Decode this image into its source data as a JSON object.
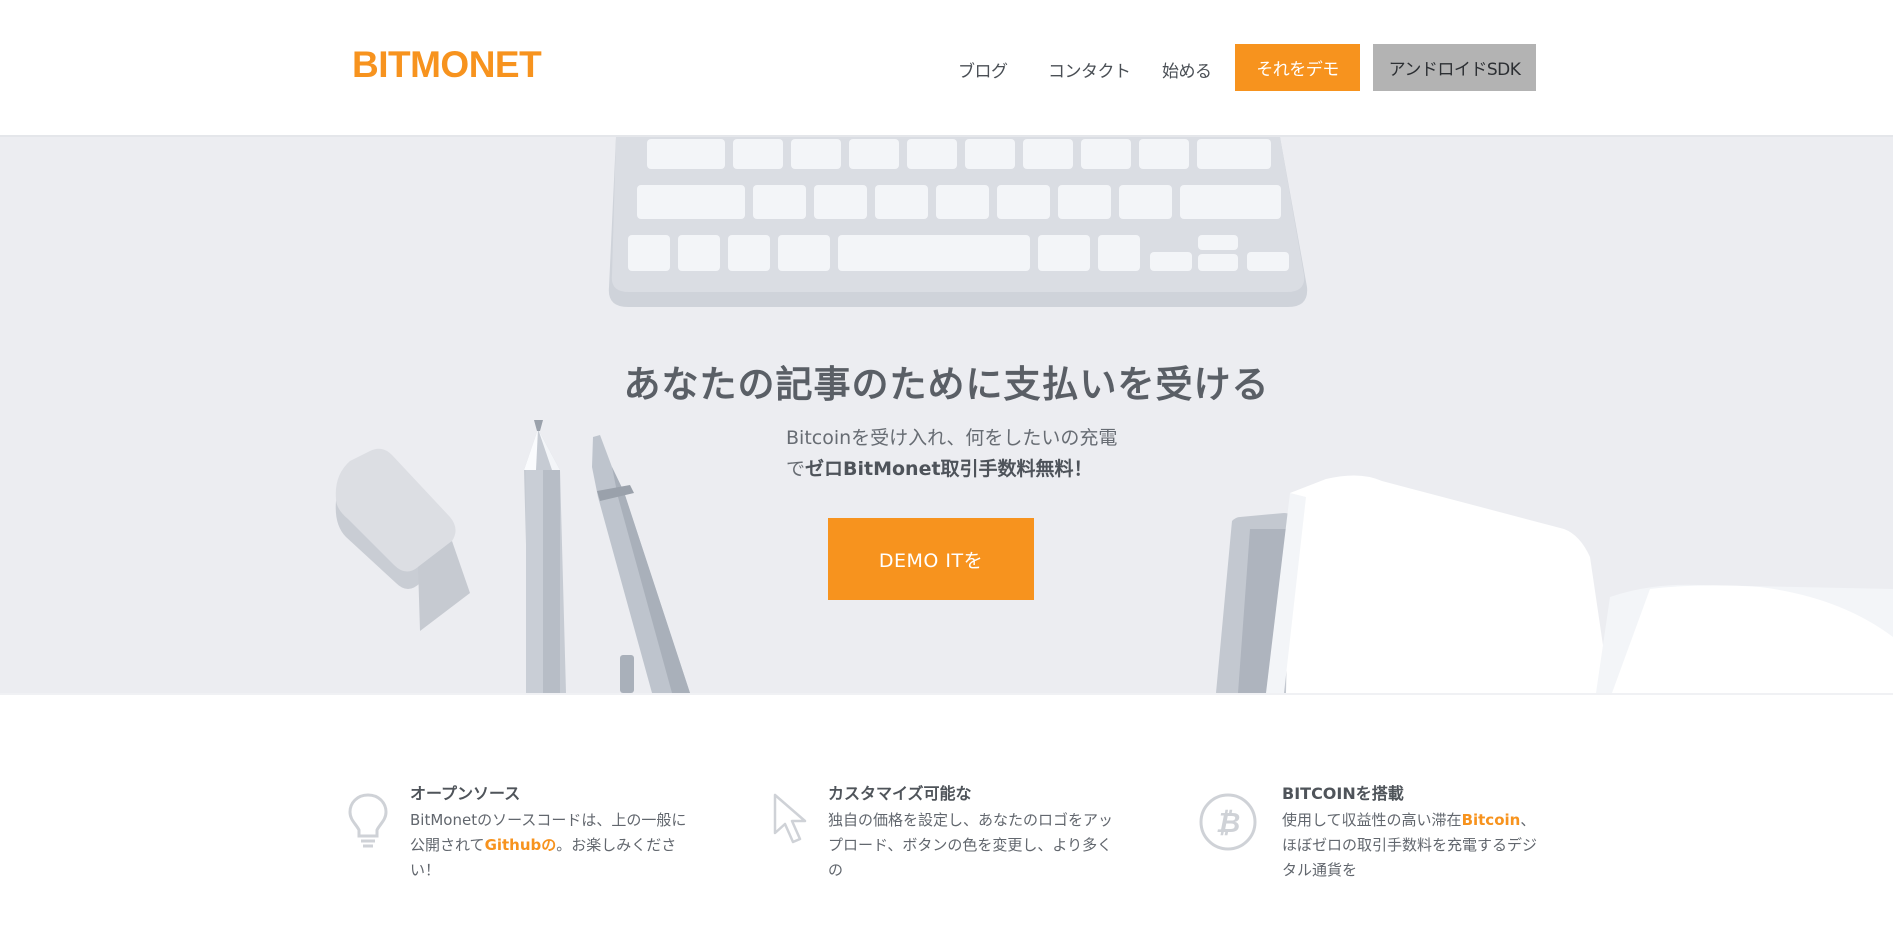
{
  "header": {
    "logo": "BITMONET",
    "nav": {
      "blog": "ブログ",
      "contact": "コンタクト",
      "start": "始める",
      "demo": "それをデモ",
      "sdk": "アンドロイドSDK"
    }
  },
  "hero": {
    "title": "あなたの記事のために支払いを受ける",
    "subtitle_line1": "Bitcoinを受け入れ、何をしたいの充電",
    "subtitle_line2_prefix": "で",
    "subtitle_line2_strong": "ゼロBitMonet取引手数料無料！",
    "cta": "DEMO ITを"
  },
  "features": [
    {
      "icon": "lightbulb-icon",
      "title": "オープンソース",
      "body_before": "BitMonetのソースコードは、上の一般に公開されて",
      "body_link": "Githubの",
      "body_after": "。お楽しみください！"
    },
    {
      "icon": "cursor-icon",
      "title": "カスタマイズ可能な",
      "body": "独自の価格を設定し、あなたのロゴをアップロード、ボタンの色を変更し、より多くの"
    },
    {
      "icon": "bitcoin-icon",
      "title": "BITCOINを搭載",
      "body_before": "使用して収益性の高い滞在",
      "body_link": "Bitcoin",
      "body_after": "、ほぼゼロの取引手数料を充電するデジタル通貨を"
    }
  ],
  "colors": {
    "accent": "#f7931e",
    "hero_bg": "#ecedf1",
    "sdk_button": "#b3b3b3"
  }
}
